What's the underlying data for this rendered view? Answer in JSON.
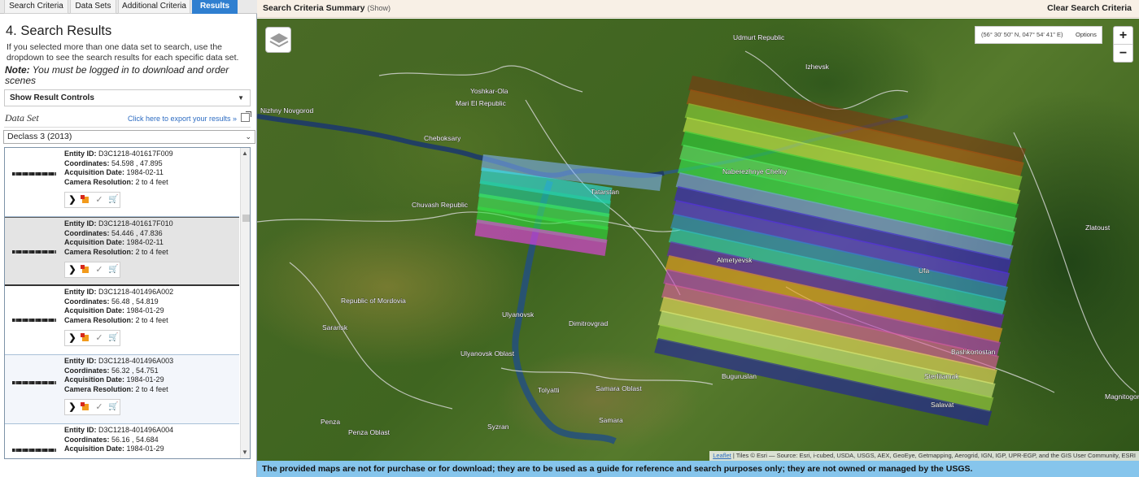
{
  "tabs": [
    {
      "label": "Search Criteria"
    },
    {
      "label": "Data Sets"
    },
    {
      "label": "Additional Criteria"
    },
    {
      "label": "Results"
    }
  ],
  "heading": "4. Search Results",
  "intro": "If you selected more than one data set to search, use the dropdown to see the search results for each specific data set.",
  "note": {
    "label": "Note:",
    "text": "You must be logged in to download and order scenes"
  },
  "result_controls": {
    "label": "Show Result Controls"
  },
  "dataset": {
    "label": "Data Set",
    "export_link": "Click here to export your results »",
    "selected": "Declass 3 (2013)"
  },
  "result_labels": {
    "entity": "Entity ID:",
    "coords": "Coordinates:",
    "date": "Acquisition Date:",
    "resolution": "Camera Resolution:"
  },
  "results": [
    {
      "entity_id": "D3C1218-401617F009",
      "coordinates": "54.598 , 47.895",
      "acquisition_date": "1984-02-11",
      "resolution": "2 to 4 feet"
    },
    {
      "entity_id": "D3C1218-401617F010",
      "coordinates": "54.446 , 47.836",
      "acquisition_date": "1984-02-11",
      "resolution": "2 to 4 feet"
    },
    {
      "entity_id": "D3C1218-401496A002",
      "coordinates": "56.48 , 54.819",
      "acquisition_date": "1984-01-29",
      "resolution": "2 to 4 feet"
    },
    {
      "entity_id": "D3C1218-401496A003",
      "coordinates": "56.32 , 54.751",
      "acquisition_date": "1984-01-29",
      "resolution": "2 to 4 feet"
    },
    {
      "entity_id": "D3C1218-401496A004",
      "coordinates": "56.16 , 54.684",
      "acquisition_date": "1984-01-29",
      "resolution": ""
    }
  ],
  "summary": {
    "title": "Search Criteria Summary",
    "toggle": "(Show)"
  },
  "clear_label": "Clear Search Criteria",
  "map": {
    "coords": "(56° 30' 50\" N, 047° 54' 41\" E)",
    "options": "Options",
    "zoom_in": "+",
    "zoom_out": "−",
    "attribution_link": "Leaflet",
    "attribution_text": " | Tiles © Esri — Source: Esri, i-cubed, USDA, USGS, AEX, GeoEye, Getmapping, Aerogrid, IGN, IGP, UPR-EGP, and the GIS User Community, ESRI",
    "places": [
      {
        "label": "Udmurt Republic"
      },
      {
        "label": "Izhevsk"
      },
      {
        "label": "Yoshkar-Ola"
      },
      {
        "label": "Mari El Republic"
      },
      {
        "label": "Nizhny Novgorod"
      },
      {
        "label": "Cheboksary"
      },
      {
        "label": "Chuvash Republic"
      },
      {
        "label": "Tatarstan"
      },
      {
        "label": "Naberezhnye Chelny"
      },
      {
        "label": "Republic of Mordovia"
      },
      {
        "label": "Saransk"
      },
      {
        "label": "Ulyanovsk"
      },
      {
        "label": "Dimitrovgrad"
      },
      {
        "label": "Ulyanovsk Oblast"
      },
      {
        "label": "Tolyatti"
      },
      {
        "label": "Samara Oblast"
      },
      {
        "label": "Samara"
      },
      {
        "label": "Syzran"
      },
      {
        "label": "Penza"
      },
      {
        "label": "Penza Oblast"
      },
      {
        "label": "Almetyevsk"
      },
      {
        "label": "Ufa"
      },
      {
        "label": "Zlatoust"
      },
      {
        "label": "Buguruslan"
      },
      {
        "label": "Bashkortostan"
      },
      {
        "label": "Magnitogorsk"
      },
      {
        "label": "Sterlitamak"
      },
      {
        "label": "Salavat"
      }
    ],
    "footprint_colors": [
      "#7a3a12",
      "#b05410",
      "#8fd63a",
      "#c9f04a",
      "#2fd43a",
      "#5cf06a",
      "#35e850",
      "#7e9cf0",
      "#3b20d0",
      "#5a30f0",
      "#2f8fd0",
      "#2fd0c0",
      "#6a20c0",
      "#f0a020",
      "#c040c0",
      "#e060a0",
      "#f0e060",
      "#d8f080",
      "#9ad040",
      "#2020a0",
      "#3a3ad0",
      "#e03010",
      "#5a40d0",
      "#30e8f0",
      "#20d0a0",
      "#40f060",
      "#30e040",
      "#f040f0"
    ]
  },
  "disclaimer": "The provided maps are not for purchase or for download; they are to be used as a guide for reference and search purposes only; they are not owned or managed by the USGS."
}
